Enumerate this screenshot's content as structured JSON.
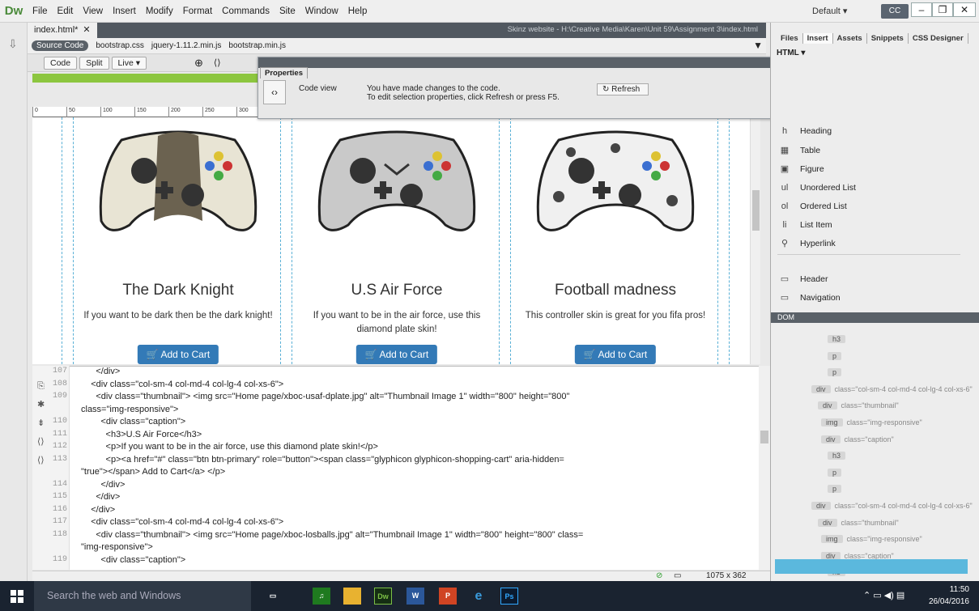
{
  "app": {
    "logo": "Dw",
    "menu": [
      "File",
      "Edit",
      "View",
      "Insert",
      "Modify",
      "Format",
      "Commands",
      "Site",
      "Window",
      "Help"
    ],
    "workspace": "Default",
    "sync": "CC"
  },
  "document": {
    "tab": "index.html*",
    "path": "Skinz website - H:\\Creative Media\\Karen\\Unit 59\\Assignment 3\\index.html",
    "related": {
      "source": "Source Code",
      "files": [
        "bootstrap.css",
        "jquery-1.11.2.min.js",
        "bootstrap.min.js"
      ]
    },
    "toolbar": {
      "code": "Code",
      "split": "Split",
      "live": "Live"
    }
  },
  "ruler": [
    "0",
    "50",
    "100",
    "150",
    "200",
    "250",
    "300"
  ],
  "properties": {
    "title": "Properties",
    "mode": "Code view",
    "message1": "You have made changes to the code.",
    "message2": "To edit selection properties, click Refresh or press F5.",
    "refresh": "Refresh"
  },
  "products": [
    {
      "title": "The Dark Knight",
      "desc": "If you want to be dark then be the dark knight!",
      "button": "Add to Cart"
    },
    {
      "title": "U.S Air Force",
      "desc": "If you want to be in the air force, use this diamond plate skin!",
      "button": "Add to Cart"
    },
    {
      "title": "Football madness",
      "desc": "This controller skin is great for you fifa pros!",
      "button": "Add to Cart"
    }
  ],
  "code": {
    "lines": [
      {
        "n": "107",
        "text": "      </div>"
      },
      {
        "n": "108",
        "text": "    <div class=\"col-sm-4 col-md-4 col-lg-4 col-xs-6\">"
      },
      {
        "n": "109",
        "text": "      <div class=\"thumbnail\"> <img src=\"Home page/xboc-usaf-dplate.jpg\" alt=\"Thumbnail Image 1\" width=\"800\" height=\"800\""
      },
      {
        "n": "",
        "text": "class=\"img-responsive\">"
      },
      {
        "n": "110",
        "text": "        <div class=\"caption\">"
      },
      {
        "n": "111",
        "text": "          <h3>U.S Air Force</h3>"
      },
      {
        "n": "112",
        "text": "          <p>If you want to be in the air force, use this diamond plate skin!</p>"
      },
      {
        "n": "113",
        "text": "          <p><a href=\"#\" class=\"btn btn-primary\" role=\"button\"><span class=\"glyphicon glyphicon-shopping-cart\" aria-hidden="
      },
      {
        "n": "",
        "text": "\"true\"></span> Add to Cart</a> </p>"
      },
      {
        "n": "114",
        "text": "        </div>"
      },
      {
        "n": "115",
        "text": "      </div>"
      },
      {
        "n": "116",
        "text": "    </div>"
      },
      {
        "n": "117",
        "text": "    <div class=\"col-sm-4 col-md-4 col-lg-4 col-xs-6\">"
      },
      {
        "n": "118",
        "text": "      <div class=\"thumbnail\"> <img src=\"Home page/xboc-losballs.jpg\" alt=\"Thumbnail Image 1\" width=\"800\" height=\"800\" class="
      },
      {
        "n": "",
        "text": "\"img-responsive\">"
      },
      {
        "n": "119",
        "text": "        <div class=\"caption\">"
      }
    ]
  },
  "status": {
    "size": "1075 x 362"
  },
  "panel": {
    "tabs": [
      "Files",
      "Insert",
      "Assets",
      "Snippets",
      "CSS Designer"
    ],
    "category": "HTML",
    "insert_items": [
      {
        "icon": "h",
        "label": "Heading"
      },
      {
        "icon": "▦",
        "label": "Table"
      },
      {
        "icon": "▣",
        "label": "Figure"
      },
      {
        "icon": "ul",
        "label": "Unordered List"
      },
      {
        "icon": "ol",
        "label": "Ordered List"
      },
      {
        "icon": "li",
        "label": "List Item"
      },
      {
        "icon": "⚲",
        "label": "Hyperlink"
      },
      {
        "icon": "▭",
        "label": "Header"
      },
      {
        "icon": "▭",
        "label": "Navigation"
      }
    ],
    "dom_title": "DOM",
    "dom": [
      {
        "tag": "h3",
        "cls": ""
      },
      {
        "tag": "p",
        "cls": ""
      },
      {
        "tag": "p",
        "cls": ""
      },
      {
        "tag": "div",
        "cls": "class=\"col-sm-4 col-md-4 col-lg-4 col-xs-6\""
      },
      {
        "tag": "div",
        "cls": "class=\"thumbnail\""
      },
      {
        "tag": "img",
        "cls": "class=\"img-responsive\""
      },
      {
        "tag": "div",
        "cls": "class=\"caption\""
      },
      {
        "tag": "h3",
        "cls": ""
      },
      {
        "tag": "p",
        "cls": ""
      },
      {
        "tag": "p",
        "cls": ""
      },
      {
        "tag": "div",
        "cls": "class=\"col-sm-4 col-md-4 col-lg-4 col-xs-6\""
      },
      {
        "tag": "div",
        "cls": "class=\"thumbnail\""
      },
      {
        "tag": "img",
        "cls": "class=\"img-responsive\""
      },
      {
        "tag": "div",
        "cls": "class=\"caption\""
      },
      {
        "tag": "h3",
        "cls": ""
      }
    ]
  },
  "taskbar": {
    "search": "Search the web and Windows",
    "apps": [
      "Dw",
      "W",
      "P",
      "Ps"
    ],
    "time": "11:50",
    "date": "26/04/2016"
  }
}
